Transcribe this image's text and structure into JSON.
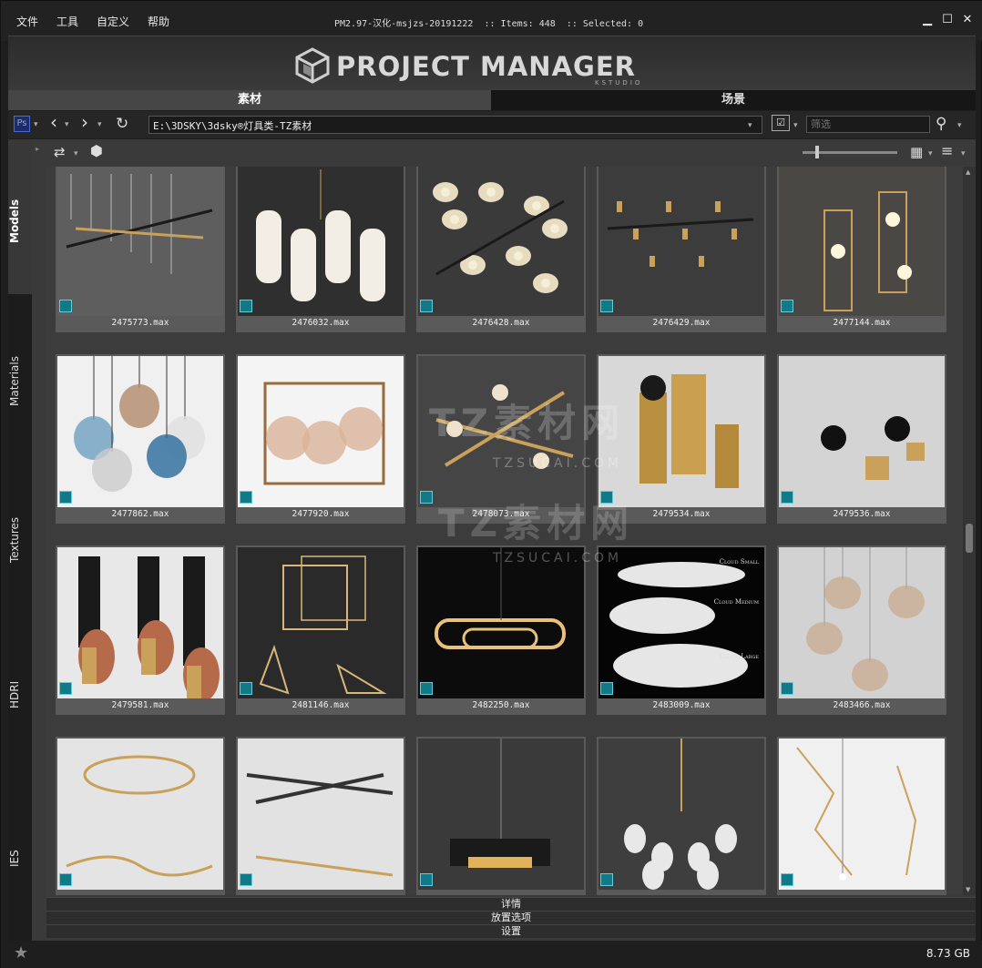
{
  "menu": {
    "file": "文件",
    "tools": "工具",
    "custom": "自定义",
    "help": "帮助"
  },
  "window": {
    "title": "PM2.97-汉化-msjzs-20191222  :: Items: 448  :: Selected: 0"
  },
  "logo": {
    "text": "PROJECT MANAGER",
    "sub": "KSTUDIO"
  },
  "tabs": {
    "assets": "素材",
    "scenes": "场景"
  },
  "toolbar": {
    "path": "E:\\3DSKY\\3dsky®灯具类-TZ素材",
    "filter_placeholder": "筛选"
  },
  "sidebar": {
    "models": "Models",
    "materials": "Materials",
    "textures": "Textures",
    "hdri": "HDRI",
    "ies": "IES"
  },
  "grid": {
    "items": [
      "2475773.max",
      "2476032.max",
      "2476428.max",
      "2476429.max",
      "2477144.max",
      "2477862.max",
      "2477920.max",
      "2478073.max",
      "2479534.max",
      "2479536.max",
      "2479581.max",
      "2481146.max",
      "2482250.max",
      "2483009.max",
      "2483466.max",
      "",
      "",
      "",
      "",
      ""
    ],
    "badge": "3ds",
    "cloud_labels": [
      "Cloud Small",
      "Cloud Medium",
      "Cloud Large"
    ]
  },
  "sections": {
    "details": "详情",
    "placement": "放置选项",
    "settings": "设置"
  },
  "status": {
    "disk": "8.73 GB"
  },
  "watermark": {
    "big": "TZ素材网",
    "small": "TZSUCAI.COM"
  }
}
